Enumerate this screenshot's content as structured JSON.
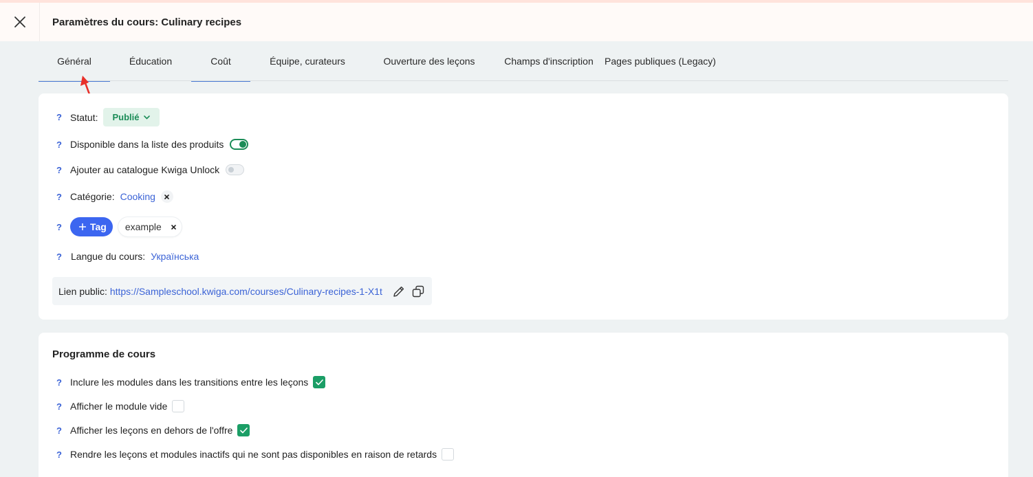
{
  "header": {
    "title": "Paramètres du cours: Culinary recipes"
  },
  "tabs": [
    {
      "label": "Général"
    },
    {
      "label": "Éducation"
    },
    {
      "label": "Coût"
    },
    {
      "label": "Équipe, curateurs"
    },
    {
      "label": "Ouverture des leçons"
    },
    {
      "label": "Champs d'inscription"
    },
    {
      "label": "Pages publiques (Legacy)"
    }
  ],
  "general": {
    "help_glyph": "?",
    "status": {
      "label": "Statut:",
      "value": "Publié"
    },
    "available_in_product_list": {
      "label": "Disponible dans la liste des produits",
      "enabled": true
    },
    "kwiga_unlock": {
      "label": "Ajouter au catalogue Kwiga Unlock",
      "enabled": false
    },
    "category": {
      "label": "Catégorie:",
      "value": "Cooking"
    },
    "tags": {
      "add_label": "Tag",
      "items": [
        "example"
      ]
    },
    "language": {
      "label": "Langue du cours:",
      "value": "Українська"
    },
    "public_link": {
      "label": "Lien public:",
      "url": "https://Sampleschool.kwiga.com/courses/Culinary-recipes-1-X1t"
    }
  },
  "program": {
    "title": "Programme de cours",
    "options": [
      {
        "label": "Inclure les modules dans les transitions entre les leçons",
        "checked": true
      },
      {
        "label": "Afficher le module vide",
        "checked": false
      },
      {
        "label": "Afficher les leçons en dehors de l'offre",
        "checked": true
      },
      {
        "label": "Rendre les leçons et modules inactifs qui ne sont pas disponibles en raison de retards",
        "checked": false
      }
    ]
  },
  "colors": {
    "accent": "#3c66f0",
    "success": "#1b8c57",
    "annotation_arrow": "#e8302a"
  }
}
